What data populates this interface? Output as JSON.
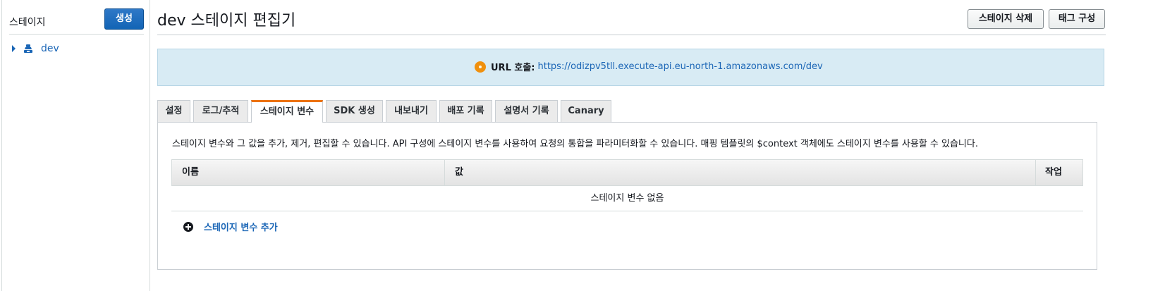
{
  "sidebar": {
    "title": "스테이지",
    "create_label": "생성",
    "stages": [
      {
        "label": "dev"
      }
    ]
  },
  "header": {
    "title": "dev 스테이지 편집기",
    "delete_label": "스테이지 삭제",
    "tags_label": "태그 구성"
  },
  "invoke": {
    "label": "URL 호출:",
    "url": "https://odizpv5tll.execute-api.eu-north-1.amazonaws.com/dev"
  },
  "tabs": [
    {
      "label": "설정",
      "active": false
    },
    {
      "label": "로그/추적",
      "active": false
    },
    {
      "label": "스테이지 변수",
      "active": true
    },
    {
      "label": "SDK 생성",
      "active": false
    },
    {
      "label": "내보내기",
      "active": false
    },
    {
      "label": "배포 기록",
      "active": false
    },
    {
      "label": "설명서 기록",
      "active": false
    },
    {
      "label": "Canary",
      "active": false
    }
  ],
  "panel": {
    "description": "스테이지 변수와 그 값을 추가, 제거, 편집할 수 있습니다. API 구성에 스테이지 변수를 사용하여 요청의 통합을 파라미터화할 수 있습니다. 매핑 템플릿의 $context 객체에도 스테이지 변수를 사용할 수 있습니다.",
    "columns": {
      "name": "이름",
      "value": "값",
      "action": "작업"
    },
    "empty_text": "스테이지 변수 없음",
    "add_label": "스테이지 변수 추가"
  },
  "colors": {
    "accent": "#ec7211",
    "link": "#1b66b6",
    "primary_button": "#1264b5",
    "info_bg": "#d8ebf4"
  },
  "icons": {
    "stage": "stage-icon",
    "tree_toggle": "caret-right-icon",
    "info": "info-dot-icon",
    "add": "plus-circle-icon"
  }
}
